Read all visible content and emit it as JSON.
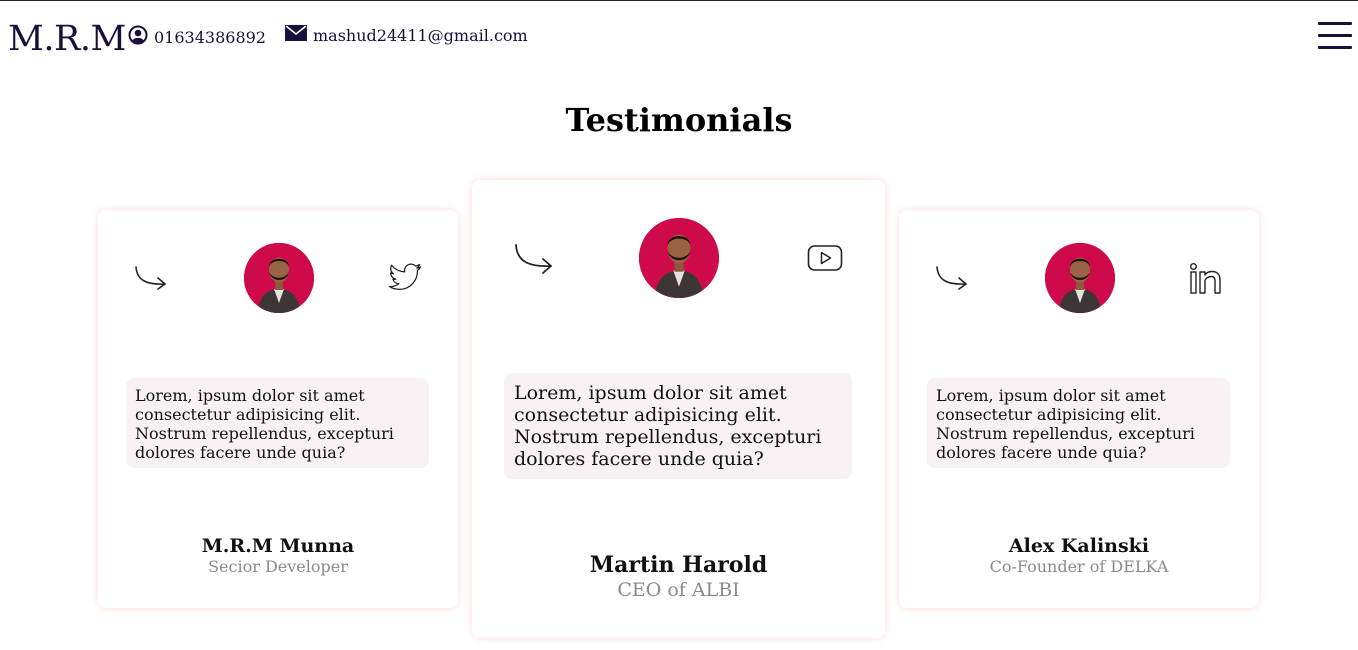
{
  "header": {
    "brand": "M.R.M",
    "phone": "01634386892",
    "email": "mashud24411@gmail.com",
    "menu_icon": "hamburger-icon",
    "phone_icon": "user-circle-icon",
    "email_icon": "envelope-icon"
  },
  "section": {
    "title": "Testimonials"
  },
  "testimonials": [
    {
      "quote": "Lorem, ipsum dolor sit amet consectetur adipisicing elit. Nostrum repellendus, excepturi dolores facere unde quia?",
      "name": "M.R.M Munna",
      "role": "Secior Developer",
      "social_icon": "twitter-icon"
    },
    {
      "quote": "Lorem, ipsum dolor sit amet consectetur adipisicing elit. Nostrum repellendus, excepturi dolores facere unde quia?",
      "name": "Martin Harold",
      "role": "CEO of ALBI",
      "social_icon": "youtube-icon"
    },
    {
      "quote": "Lorem, ipsum dolor sit amet consectetur adipisicing elit. Nostrum repellendus, excepturi dolores facere unde quia?",
      "name": "Alex Kalinski",
      "role": "Co-Founder of DELKA",
      "social_icon": "linkedin-icon"
    }
  ],
  "colors": {
    "brand_text": "#1a0f3a",
    "avatar_bg": "#cf0a4a",
    "quote_bg": "#f8f1f3",
    "role_text": "#8a8a8a"
  }
}
